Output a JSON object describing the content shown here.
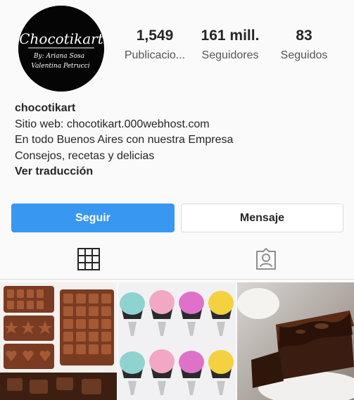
{
  "profile": {
    "avatar_text": {
      "brand": "Chocotikart",
      "by_line": "By: Ariana Sosa",
      "name_line": "Valentina Petrucci"
    },
    "stats": [
      {
        "value": "1,549",
        "label": "Publicacio..."
      },
      {
        "value": "161 mill.",
        "label": "Seguidores"
      },
      {
        "value": "83",
        "label": "Seguidos"
      }
    ],
    "username": "chocotikart",
    "bio_lines": [
      "Sitio web: chocotikart.000webhost.com",
      "En todo Buenos Aires con nuestra Empresa",
      "Consejos, recetas y delicias"
    ],
    "translate_label": "Ver traducción"
  },
  "actions": {
    "follow_label": "Seguir",
    "message_label": "Mensaje"
  },
  "tabs": [
    {
      "icon": "grid-icon",
      "active": true
    },
    {
      "icon": "tagged-person-icon",
      "active": false
    }
  ],
  "posts": [
    {
      "subject": "chocolate-molds"
    },
    {
      "subject": "cupcakes-piping-tips"
    },
    {
      "subject": "chocolate-brownie"
    }
  ],
  "colors": {
    "accent": "#3897f0",
    "text": "#262626",
    "muted": "#555555",
    "background": "#fafafa",
    "border": "#dbdbdb"
  }
}
